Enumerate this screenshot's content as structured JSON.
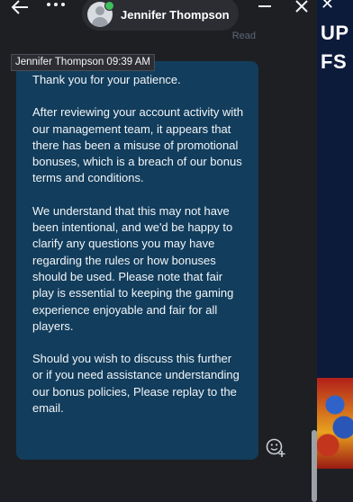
{
  "window": {
    "contact_name": "Jennifer Thompson",
    "tooltip": "Jennifer Thompson 09:39 AM",
    "icons": {
      "back": "back-arrow-icon",
      "more": "more-options-icon",
      "minimize": "minimize-icon",
      "close": "close-icon",
      "react": "add-reaction-icon"
    }
  },
  "message": {
    "paragraphs": [
      "Thank you for your patience.",
      "After reviewing your account activity with our management team, it appears that there has been a misuse of promotional bonuses, which is a breach of our bonus terms and conditions.",
      "We understand that this may not have been intentional, and we'd be happy to clarify any questions you may have regarding the rules or how bonuses should be used. Please note that fair play is essential to keeping the gaming experience enjoyable and fair for all players.",
      "Should you wish to discuss this further or if you need assistance understanding our bonus policies, Please replay to the email."
    ]
  },
  "background": {
    "read_label": "Read",
    "text_up": "UP",
    "text_fs": "FS",
    "close_glyph": "✕"
  },
  "colors": {
    "bubble": "#123d5c",
    "online": "#3fbf5c",
    "window_bg": "#1e1f23"
  }
}
